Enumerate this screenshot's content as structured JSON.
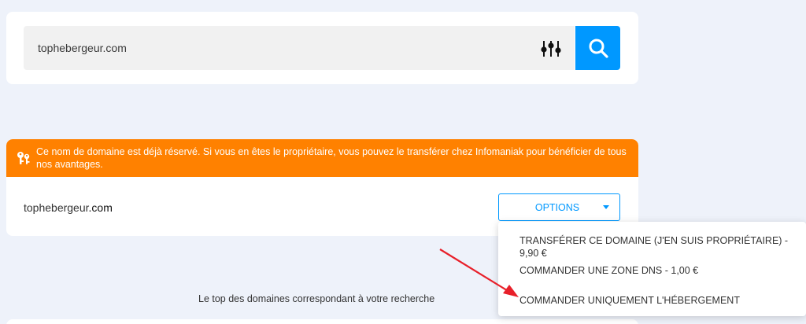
{
  "search": {
    "value": "tophebergeur.com",
    "filter_icon": "sliders-icon",
    "search_icon": "search-icon",
    "accent_color": "#0098ff"
  },
  "alert": {
    "icon": "keys-icon",
    "text": "Ce nom de domaine est déjà réservé. Si vous en êtes le propriétaire, vous pouvez le transférer chez Infomaniak pour bénéficier de tous nos avantages.",
    "color": "#ff8100"
  },
  "result": {
    "domain_base": "tophebergeur",
    "domain_tld": ".com",
    "options_label": "OPTIONS"
  },
  "dropdown": {
    "items": [
      {
        "label": "TRANSFÉRER CE DOMAINE (J'EN SUIS PROPRIÉTAIRE) - 9,90 €"
      },
      {
        "label": "COMMANDER UNE ZONE DNS - 1,00 €"
      },
      {
        "label": "COMMANDER UNIQUEMENT L'HÉBERGEMENT"
      }
    ]
  },
  "section": {
    "top_domains_text": "Le top des domaines correspondant à votre recherche"
  },
  "annotation": {
    "arrow_color": "#e8202a"
  }
}
